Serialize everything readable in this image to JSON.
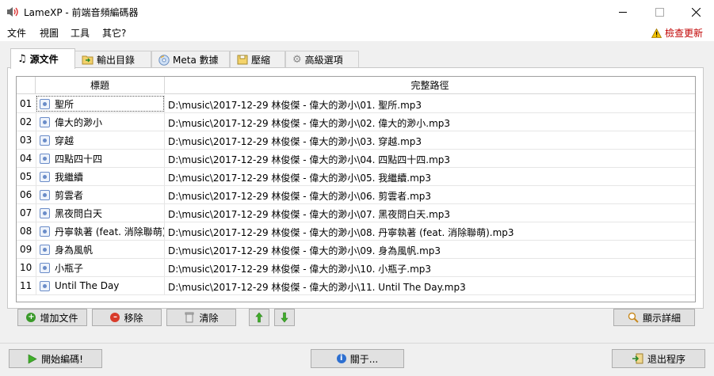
{
  "window": {
    "title": "LameXP - 前端音頻編碼器"
  },
  "menu": {
    "items": [
      "文件",
      "視圖",
      "工具",
      "其它?"
    ],
    "update_label": "檢查更新"
  },
  "tabs": [
    {
      "label": "源文件",
      "icon": "music-note-icon"
    },
    {
      "label": "輸出目錄",
      "icon": "folder-arrow-icon"
    },
    {
      "label": "Meta 數據",
      "icon": "cd-icon"
    },
    {
      "label": "壓縮",
      "icon": "compress-icon"
    },
    {
      "label": "高級選項",
      "icon": "gear-icon"
    }
  ],
  "table": {
    "columns": [
      "標題",
      "完整路徑"
    ],
    "rows": [
      {
        "num": "01",
        "title": "聖所",
        "path": "D:\\music\\2017-12-29 林俊傑 - 偉大的渺小\\01. 聖所.mp3"
      },
      {
        "num": "02",
        "title": "偉大的渺小",
        "path": "D:\\music\\2017-12-29 林俊傑 - 偉大的渺小\\02. 偉大的渺小.mp3"
      },
      {
        "num": "03",
        "title": "穿越",
        "path": "D:\\music\\2017-12-29 林俊傑 - 偉大的渺小\\03. 穿越.mp3"
      },
      {
        "num": "04",
        "title": "四點四十四",
        "path": "D:\\music\\2017-12-29 林俊傑 - 偉大的渺小\\04. 四點四十四.mp3"
      },
      {
        "num": "05",
        "title": "我繼續",
        "path": "D:\\music\\2017-12-29 林俊傑 - 偉大的渺小\\05. 我繼續.mp3"
      },
      {
        "num": "06",
        "title": "剪雲者",
        "path": "D:\\music\\2017-12-29 林俊傑 - 偉大的渺小\\06. 剪雲者.mp3"
      },
      {
        "num": "07",
        "title": "黑夜問白天",
        "path": "D:\\music\\2017-12-29 林俊傑 - 偉大的渺小\\07. 黑夜問白天.mp3"
      },
      {
        "num": "08",
        "title": "丹寧執著 (feat. 消除聯萌)",
        "path": "D:\\music\\2017-12-29 林俊傑 - 偉大的渺小\\08. 丹寧執著 (feat. 消除聯萌).mp3"
      },
      {
        "num": "09",
        "title": "身為風帆",
        "path": "D:\\music\\2017-12-29 林俊傑 - 偉大的渺小\\09. 身為風帆.mp3"
      },
      {
        "num": "10",
        "title": "小瓶子",
        "path": "D:\\music\\2017-12-29 林俊傑 - 偉大的渺小\\10. 小瓶子.mp3"
      },
      {
        "num": "11",
        "title": "Until The Day",
        "path": "D:\\music\\2017-12-29 林俊傑 - 偉大的渺小\\11. Until The Day.mp3"
      }
    ]
  },
  "buttons": {
    "add": "增加文件",
    "remove": "移除",
    "clear": "清除",
    "details": "顯示詳細",
    "start": "開始編碼!",
    "about": "關于...",
    "exit": "退出程序"
  },
  "colors": {
    "accent_green": "#3a9a2a",
    "remove_red": "#d83b2a",
    "info_blue": "#2d6fd0",
    "update_red": "#c00000"
  }
}
